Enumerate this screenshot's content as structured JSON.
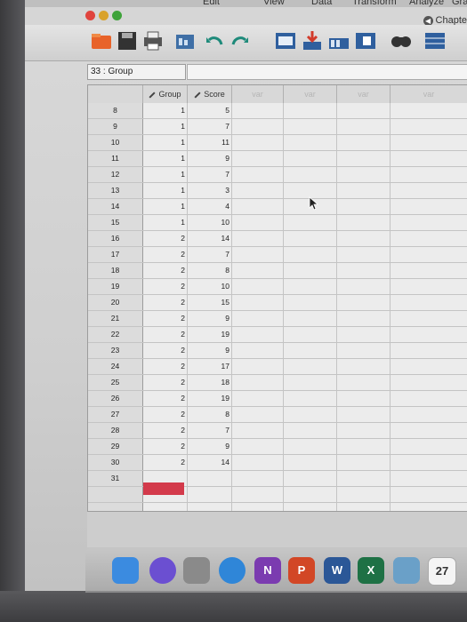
{
  "menubar": {
    "items": [
      "Edit",
      "View",
      "Data",
      "Transform",
      "Analyze",
      "Graphs"
    ]
  },
  "titlebar": {
    "chapter_tab": "Chapte"
  },
  "editor": {
    "cell_ref": "33 : Group",
    "cell_value": ""
  },
  "grid": {
    "columns": [
      "Group",
      "Score",
      "var",
      "var",
      "var",
      "var"
    ],
    "rows": [
      {
        "n": "8",
        "group": "1",
        "score": "5"
      },
      {
        "n": "9",
        "group": "1",
        "score": "7"
      },
      {
        "n": "10",
        "group": "1",
        "score": "11"
      },
      {
        "n": "11",
        "group": "1",
        "score": "9"
      },
      {
        "n": "12",
        "group": "1",
        "score": "7"
      },
      {
        "n": "13",
        "group": "1",
        "score": "3"
      },
      {
        "n": "14",
        "group": "1",
        "score": "4"
      },
      {
        "n": "15",
        "group": "1",
        "score": "10"
      },
      {
        "n": "16",
        "group": "2",
        "score": "14"
      },
      {
        "n": "17",
        "group": "2",
        "score": "7"
      },
      {
        "n": "18",
        "group": "2",
        "score": "8"
      },
      {
        "n": "19",
        "group": "2",
        "score": "10"
      },
      {
        "n": "20",
        "group": "2",
        "score": "15"
      },
      {
        "n": "21",
        "group": "2",
        "score": "9"
      },
      {
        "n": "22",
        "group": "2",
        "score": "19"
      },
      {
        "n": "23",
        "group": "2",
        "score": "9"
      },
      {
        "n": "24",
        "group": "2",
        "score": "17"
      },
      {
        "n": "25",
        "group": "2",
        "score": "18"
      },
      {
        "n": "26",
        "group": "2",
        "score": "19"
      },
      {
        "n": "27",
        "group": "2",
        "score": "8"
      },
      {
        "n": "28",
        "group": "2",
        "score": "7"
      },
      {
        "n": "29",
        "group": "2",
        "score": "9"
      },
      {
        "n": "30",
        "group": "2",
        "score": "14"
      },
      {
        "n": "31",
        "group": "",
        "score": ""
      }
    ]
  },
  "colors": {
    "selected_cell": "#d33a4b",
    "grid_background": "#ececec"
  },
  "dock": {
    "apps": [
      {
        "name": "finder-icon",
        "label": "",
        "color": "#3b8be0"
      },
      {
        "name": "siri-icon",
        "label": "",
        "color": "#6b4fd1"
      },
      {
        "name": "launchpad-icon",
        "label": "",
        "color": "#8a8a8a"
      },
      {
        "name": "safari-icon",
        "label": "",
        "color": "#2f86d8"
      },
      {
        "name": "onenote-icon",
        "label": "N",
        "color": "#7b3bb0"
      },
      {
        "name": "powerpoint-icon",
        "label": "P",
        "color": "#d24726"
      },
      {
        "name": "word-icon",
        "label": "W",
        "color": "#2b5797"
      },
      {
        "name": "excel-icon",
        "label": "X",
        "color": "#1e7145"
      },
      {
        "name": "preview-icon",
        "label": "",
        "color": "#6aa0c8"
      },
      {
        "name": "calendar-icon",
        "label": "27",
        "color": "#f4f4f4"
      }
    ]
  }
}
